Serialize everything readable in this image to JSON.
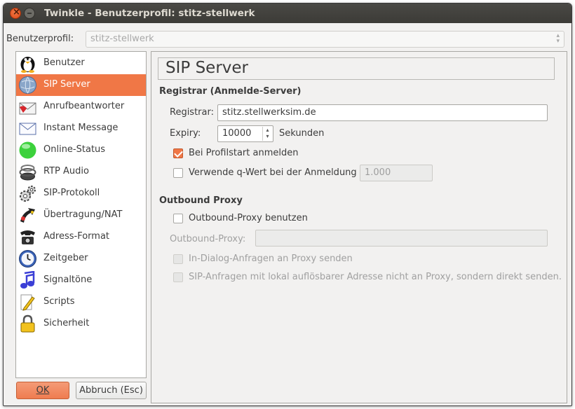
{
  "window": {
    "title": "Twinkle - Benutzerprofil: stitz-stellwerk"
  },
  "profile": {
    "label": "Benutzerprofil:",
    "value": "stitz-stellwerk"
  },
  "sidebar": {
    "items": [
      {
        "label": "Benutzer",
        "icon": "penguin-user-icon"
      },
      {
        "label": "SIP Server",
        "icon": "globe-server-icon",
        "selected": true
      },
      {
        "label": "Anrufbeantworter",
        "icon": "envelope-voicemail-icon"
      },
      {
        "label": "Instant Message",
        "icon": "envelope-message-icon"
      },
      {
        "label": "Online-Status",
        "icon": "green-status-icon"
      },
      {
        "label": "RTP Audio",
        "icon": "speaker-icon"
      },
      {
        "label": "SIP-Protokoll",
        "icon": "gears-icon"
      },
      {
        "label": "Übertragung/NAT",
        "icon": "transfer-icon"
      },
      {
        "label": "Adress-Format",
        "icon": "telephone-icon"
      },
      {
        "label": "Zeitgeber",
        "icon": "clock-icon"
      },
      {
        "label": "Signaltöne",
        "icon": "music-note-icon"
      },
      {
        "label": "Scripts",
        "icon": "pencil-document-icon"
      },
      {
        "label": "Sicherheit",
        "icon": "padlock-icon"
      }
    ]
  },
  "buttons": {
    "ok": "OK",
    "cancel": "Abbruch (Esc)"
  },
  "page": {
    "heading": "SIP Server",
    "registrar_group": {
      "title": "Registrar (Anmelde-Server)",
      "registrar_label": "Registrar:",
      "registrar_value": "stitz.stellwerksim.de",
      "expiry_label": "Expiry:",
      "expiry_value": "10000",
      "expiry_unit": "Sekunden",
      "register_at_start_label": "Bei Profilstart anmelden",
      "register_at_start_checked": true,
      "qvalue_label": "Verwende q-Wert bei der Anmeldung",
      "qvalue_checked": false,
      "qvalue_value": "1.000"
    },
    "proxy_group": {
      "title": "Outbound Proxy",
      "use_proxy_label": "Outbound-Proxy benutzen",
      "use_proxy_checked": false,
      "proxy_label": "Outbound-Proxy:",
      "proxy_value": "",
      "in_dialog_label": "In-Dialog-Anfragen an Proxy senden",
      "local_address_label": "SIP-Anfragen mit lokal auflösbarer Adresse nicht an Proxy, sondern direkt senden."
    }
  },
  "colors": {
    "accent": "#f07746",
    "titlebar": "#3c3b37",
    "window_bg": "#f2f1f0"
  }
}
